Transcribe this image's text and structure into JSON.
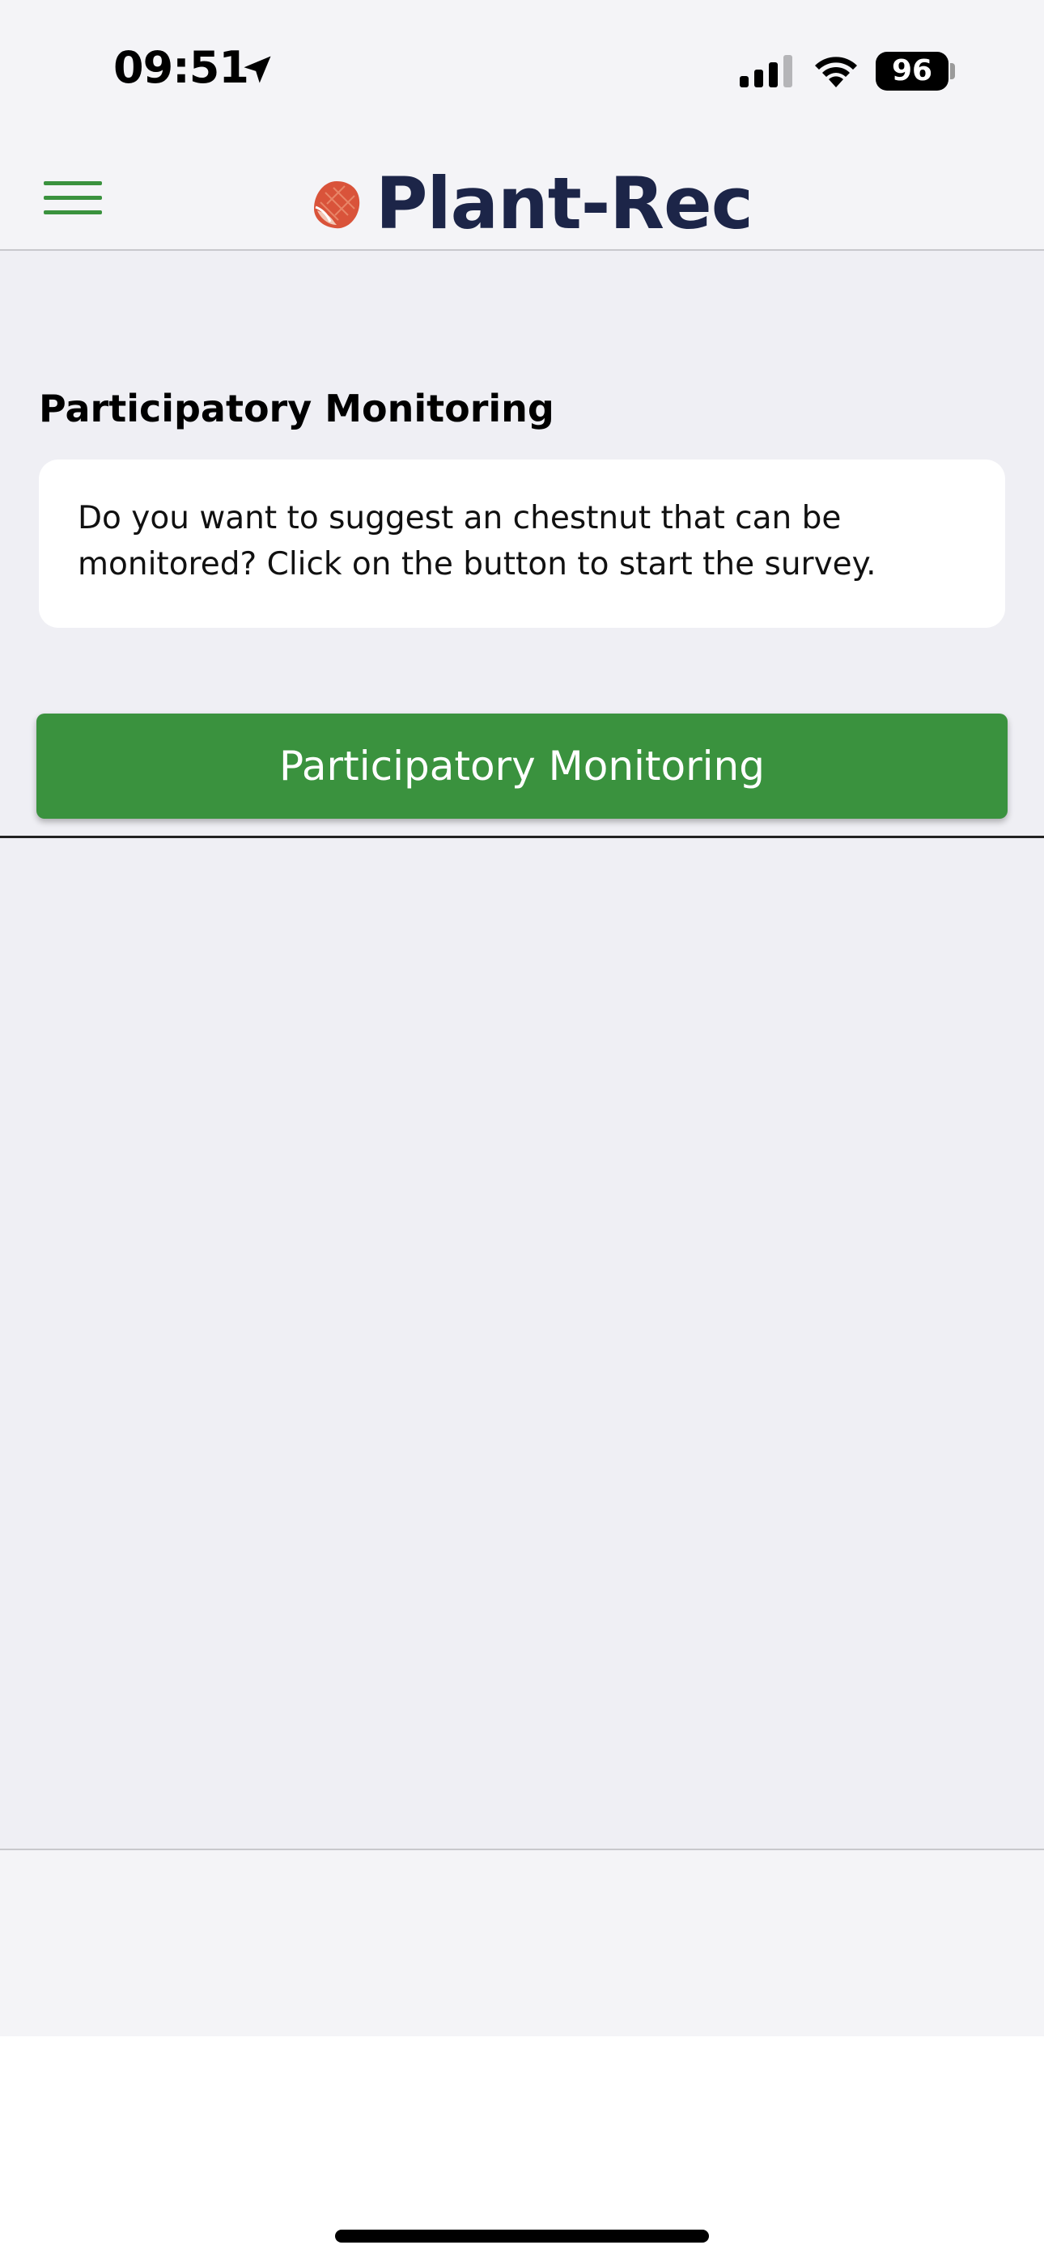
{
  "status_bar": {
    "time": "09:51",
    "battery_level": "96",
    "icons": [
      "location-arrow-icon",
      "cellular-signal-icon",
      "wifi-icon",
      "battery-icon"
    ]
  },
  "header": {
    "menu_icon": "hamburger-menu-icon",
    "brand_name": "Plant-Rec",
    "brand_color": "#1c2548",
    "logo_icon": "chestnut-logo-icon",
    "logo_color": "#d9533a"
  },
  "main": {
    "section_title": "Participatory Monitoring",
    "info_text": "Do you want to suggest an chestnut that can be monitored? Click on the button to start the survey.",
    "button_label": "Participatory Monitoring",
    "accent_color": "#3a923e"
  }
}
